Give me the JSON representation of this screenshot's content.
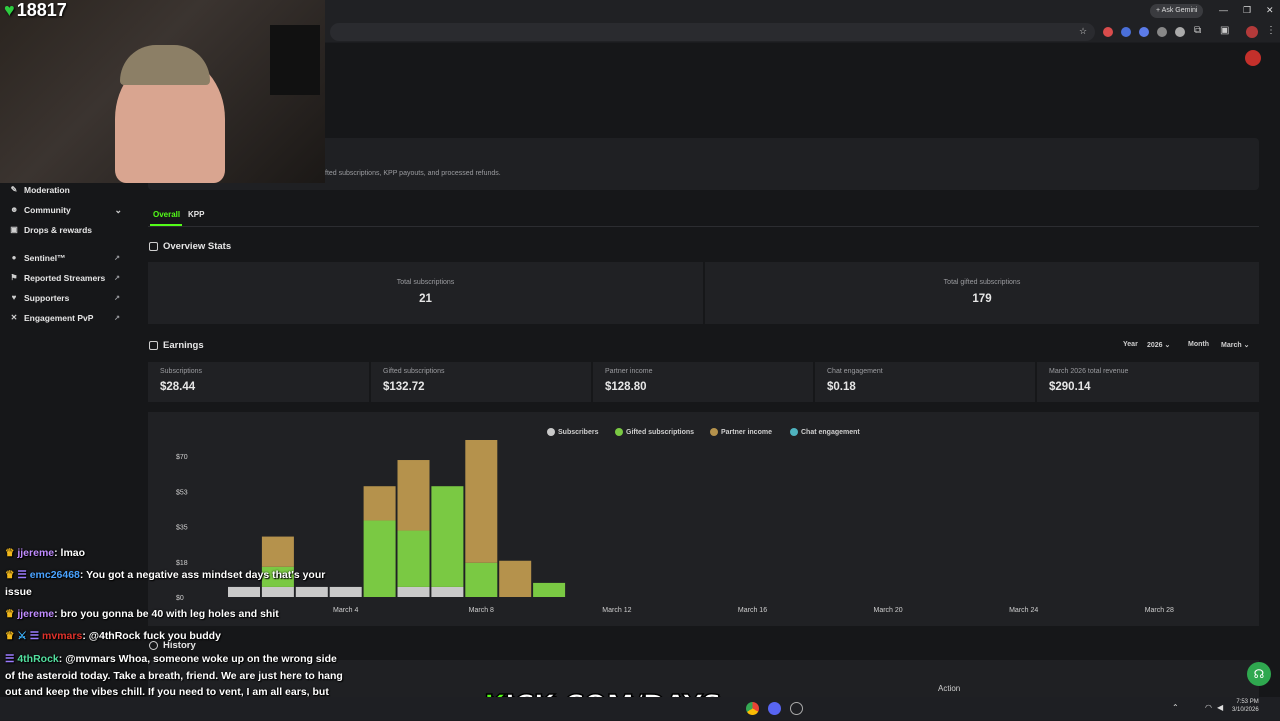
{
  "stream_overlay": {
    "subscriber_count": "18817",
    "banner_text": "KICK.COM/DAYS"
  },
  "browser": {
    "ask_gemini": "Ask Gemini"
  },
  "page": {
    "description_fragment": "fted subscriptions, KPP payouts, and processed refunds."
  },
  "sidebar": {
    "items": [
      {
        "label": "Moderation",
        "icon": "wrench-icon"
      },
      {
        "label": "Community",
        "icon": "people-icon",
        "chevron": true
      },
      {
        "label": "Drops & rewards",
        "icon": "gift-icon"
      },
      {
        "label": "Sentinel™",
        "icon": "shield-icon",
        "external": true
      },
      {
        "label": "Reported Streamers",
        "icon": "flag-icon",
        "external": true
      },
      {
        "label": "Supporters",
        "icon": "heart-icon",
        "external": true
      },
      {
        "label": "Engagement PvP",
        "icon": "versus-icon",
        "external": true
      }
    ]
  },
  "tabs": [
    {
      "label": "Overall",
      "active": true
    },
    {
      "label": "KPP",
      "active": false
    }
  ],
  "overview": {
    "title": "Overview Stats",
    "stats": [
      {
        "label": "Total subscriptions",
        "value": "21"
      },
      {
        "label": "Total gifted subscriptions",
        "value": "179"
      }
    ]
  },
  "earnings": {
    "title": "Earnings",
    "year_label": "Year",
    "year_value": "2026",
    "month_label": "Month",
    "month_value": "March",
    "cards": [
      {
        "label": "Subscriptions",
        "value": "$28.44"
      },
      {
        "label": "Gifted subscriptions",
        "value": "$132.72"
      },
      {
        "label": "Partner income",
        "value": "$128.80"
      },
      {
        "label": "Chat engagement",
        "value": "$0.18"
      },
      {
        "label": "March 2026 total revenue",
        "value": "$290.14"
      }
    ]
  },
  "history": {
    "title": "History",
    "action_header": "Action"
  },
  "chat": [
    {
      "user": "jjereme",
      "user_color": "#c08cff",
      "badges": [
        "crown"
      ],
      "text": "lmao"
    },
    {
      "user": "emc26468",
      "user_color": "#4aa3ff",
      "badges": [
        "crown",
        "sub"
      ],
      "text": "You got a negative ass mindset days that's your issue"
    },
    {
      "user": "jjereme",
      "user_color": "#c08cff",
      "badges": [
        "crown"
      ],
      "text": "bro you gonna be 40 with leg holes and shit"
    },
    {
      "user": "mvmars",
      "user_color": "#e0322b",
      "badges": [
        "crown",
        "sword",
        "sub"
      ],
      "text": "@4thRock fuck you buddy"
    },
    {
      "user": "4thRock",
      "user_color": "#53e0a0",
      "badges": [
        "sub"
      ],
      "text": "@mvmars Whoa, someone woke up on the wrong side of the asteroid today. Take a breath, friend. We are just here to hang out and keep the vibes chill. If you need to vent, I am all ears, but let's keep it friendly in the chat!"
    }
  ],
  "taskbar": {
    "time": "7:53 PM",
    "date": "3/10/2026"
  },
  "colors": {
    "accent": "#53fc18",
    "subscribers": "#c9c9c9",
    "gifted": "#7ac943",
    "partner": "#b5924c",
    "chat_engagement": "#4fb3bf"
  },
  "chart_data": {
    "type": "bar",
    "stacked": true,
    "x_tick_labels": [
      "March 4",
      "March 8",
      "March 12",
      "March 16",
      "March 20",
      "March 24",
      "March 28"
    ],
    "y_tick_labels": [
      "$0",
      "$18",
      "$35",
      "$53",
      "$70"
    ],
    "ylim": [
      0,
      70
    ],
    "legend": [
      "Subscribers",
      "Gifted subscriptions",
      "Partner income",
      "Chat engagement"
    ],
    "legend_position": "top-center",
    "days": [
      1,
      2,
      3,
      4,
      5,
      6,
      7,
      8,
      9,
      10
    ],
    "series": [
      {
        "name": "Subscribers",
        "color": "#c9c9c9",
        "values": [
          5,
          5,
          5,
          5,
          0,
          5,
          5,
          0,
          0,
          0
        ]
      },
      {
        "name": "Gifted subscriptions",
        "color": "#7ac943",
        "values": [
          0,
          10,
          0,
          0,
          38,
          28,
          50,
          17,
          0,
          7
        ]
      },
      {
        "name": "Partner income",
        "color": "#b5924c",
        "values": [
          0,
          15,
          0,
          0,
          17,
          35,
          0,
          62,
          18,
          0
        ]
      },
      {
        "name": "Chat engagement",
        "color": "#4fb3bf",
        "values": [
          0,
          0,
          0,
          0,
          0,
          0,
          0,
          0,
          0,
          0
        ]
      }
    ]
  }
}
